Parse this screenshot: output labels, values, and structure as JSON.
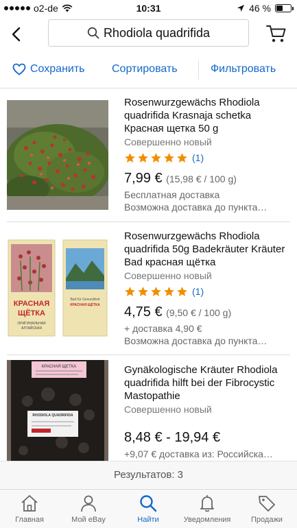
{
  "status_bar": {
    "carrier": "o2-de",
    "time": "10:31",
    "battery": "46 %",
    "battery_level": 0.46
  },
  "header": {
    "search_query": "Rhodiola quadrifida"
  },
  "actions": {
    "save": "Сохранить",
    "sort": "Сортировать",
    "filter": "Фильтровать"
  },
  "colors": {
    "accent": "#1468c9",
    "star": "#f18e00"
  },
  "listings": [
    {
      "title": "Rosenwurzgewächs Rhodiola quadrifida Krasnaja schetka Красная щетка 50 g",
      "condition": "Совершенно новый",
      "rating": 5,
      "rating_count": "(1)",
      "price": "7,99 €",
      "unit_price": "(15,98 € / 100 g)",
      "shipping": "Бесплатная доставка",
      "delivery": "Возможна доставка до пункта…"
    },
    {
      "title": "Rosenwurzgewächs Rhodiola quadrifida 50g Badekräuter Kräuter Bad красная щётка",
      "condition": "Совершенно новый",
      "rating": 5,
      "rating_count": "(1)",
      "price": "4,75 €",
      "unit_price": "(9,50 € / 100 g)",
      "shipping": "+ доставка 4,90 €",
      "delivery": "Возможна доставка до пункта…",
      "package_left_text": "КРАСНАЯ ЩЁТКА",
      "package_left_subtext": "ОРИГИНАЛЬНАЯ АЛТАЙСКАЯ",
      "package_right_text": "Bad für Gesundheit КРАСНАЯ ЩЁТКА"
    },
    {
      "title": "Gynäkologische Kräuter Rhodiola quadrifida hilft bei der Fibrocystic Mastopathie",
      "condition": "Совершенно новый",
      "price": "8,48 € - 19,94 €",
      "shipping": "+9,07 € доставка из: Российска…",
      "label_top": "КРАСНАЯ ЩЕТКА",
      "label_bottom": "RHODIOLA QUADRIFIDA"
    }
  ],
  "results": "Результатов: 3",
  "tabs": [
    {
      "label": "Главная",
      "icon": "home-icon",
      "active": false
    },
    {
      "label": "Мой eBay",
      "icon": "user-icon",
      "active": false
    },
    {
      "label": "Найти",
      "icon": "search-icon",
      "active": true
    },
    {
      "label": "Уведомления",
      "icon": "bell-icon",
      "active": false
    },
    {
      "label": "Продажи",
      "icon": "tag-icon",
      "active": false
    }
  ]
}
